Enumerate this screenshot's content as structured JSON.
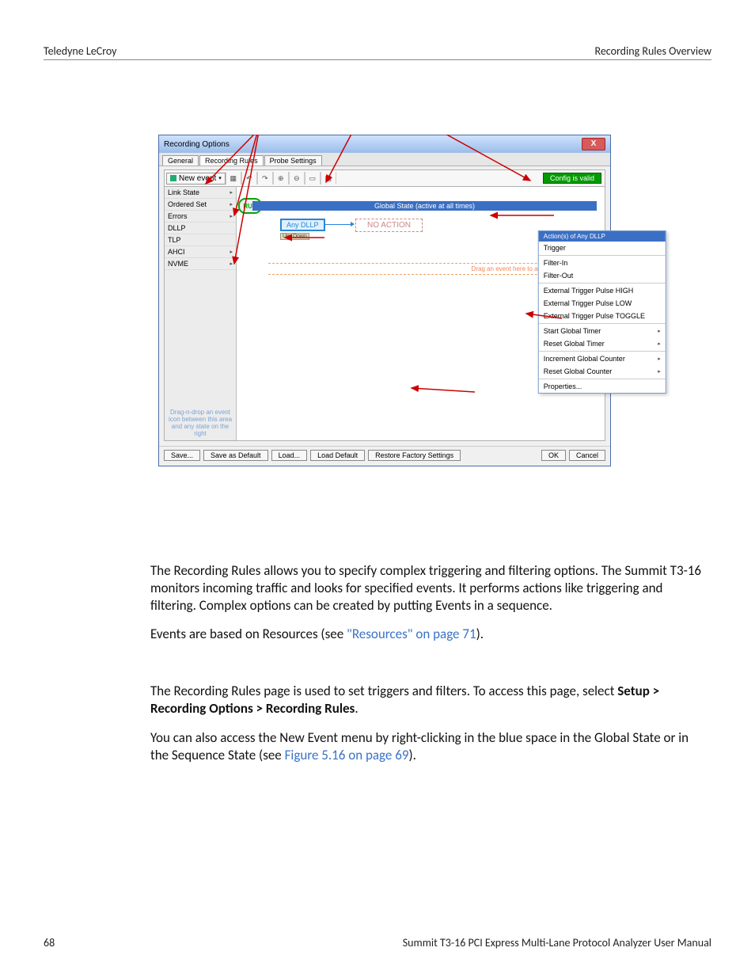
{
  "header": {
    "left": "Teledyne LeCroy",
    "right": "Recording Rules Overview"
  },
  "footer": {
    "page": "68",
    "title": "Summit T3-16 PCI Express Multi-Lane Protocol Analyzer User Manual"
  },
  "win": {
    "title": "Recording Options",
    "tabs": [
      {
        "label": "General",
        "active": false
      },
      {
        "label": "Recording Rules",
        "active": true
      },
      {
        "label": "Probe Settings",
        "active": false
      }
    ],
    "toolbar": {
      "new_event": "New event",
      "config_valid": "Config is valid"
    },
    "event_categories": [
      {
        "label": "Link State",
        "submenu": true
      },
      {
        "label": "Ordered Set",
        "submenu": true
      },
      {
        "label": "Errors",
        "submenu": true
      },
      {
        "label": "DLLP",
        "submenu": false
      },
      {
        "label": "TLP",
        "submenu": false
      },
      {
        "label": "AHCI",
        "submenu": true
      },
      {
        "label": "NVME",
        "submenu": true
      }
    ],
    "drag_hint": "Drag-n-drop an event icon between this area and any state on the right",
    "run": "RUN",
    "global_state": "Global State (active at all times)",
    "event_block": "Any DLLP",
    "updown": {
      "up": "Up",
      "down": "Down"
    },
    "action_block": "NO ACTION",
    "drop_hint": "Drag an event here to add a new sequence",
    "context_menu": {
      "header": "Action(s) of Any DLLP",
      "items": [
        "Trigger",
        "Filter-In",
        "Filter-Out",
        "External Trigger Pulse HIGH",
        "External Trigger Pulse LOW",
        "External Trigger Pulse TOGGLE",
        "Start Global Timer",
        "Reset Global Timer",
        "Increment Global Counter",
        "Reset Global Counter",
        "Properties..."
      ],
      "has_sub": {
        "6": true,
        "7": true,
        "8": true,
        "9": true
      }
    },
    "buttons": {
      "save": "Save...",
      "save_default": "Save as Default",
      "load": "Load...",
      "load_default": "Load Default",
      "restore": "Restore Factory Settings",
      "ok": "OK",
      "cancel": "Cancel"
    }
  },
  "body": {
    "p1": "The Recording Rules allows you to specify complex triggering and filtering options. The Summit T3-16 monitors incoming traffic and looks for specified events. It performs actions like triggering and filtering. Complex options can be created by putting Events in a sequence.",
    "p2a": "Events are based on Resources (see ",
    "p2link": "\"Resources\" on page 71",
    "p2b": ").",
    "p3a": "The Recording Rules page is used to set triggers and filters. To access this page, select ",
    "p3b": "Setup > Recording Options > Recording Rules",
    "p3c": ".",
    "p4a": "You can also access the New Event menu by right-clicking in the blue space in the Global State or in the Sequence State (see ",
    "p4link": "Figure 5.16 on page 69",
    "p4b": ")."
  }
}
